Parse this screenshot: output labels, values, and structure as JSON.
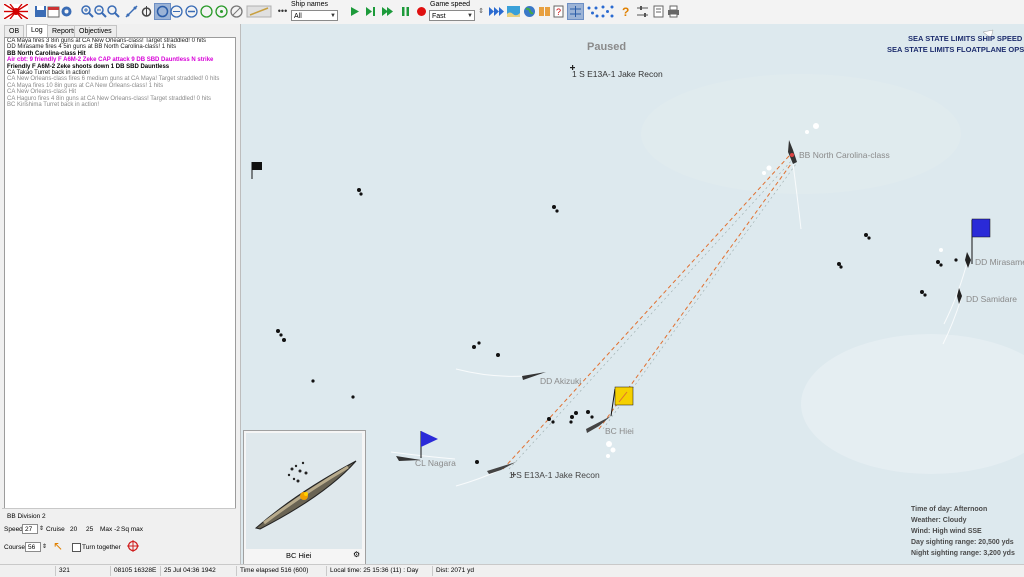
{
  "toolbar": {
    "ship_names_label": "Ship names",
    "ship_names_value": "All",
    "game_speed_label": "Game speed",
    "game_speed_value": "Fast"
  },
  "left_panel": {
    "tabs": [
      "OB",
      "Log",
      "Reports",
      "Objectives"
    ],
    "active_tab": "Log",
    "log": [
      {
        "text": "CA Maya fires 3 8in guns at CA New Orleans-class! Target straddled!  0 hits",
        "style": "dark"
      },
      {
        "text": "DD Mirasame fires 4 5in guns at BB North Carolina-class! 1 hits",
        "style": "dark"
      },
      {
        "text": "BB North Carolina-class Hit",
        "style": "bold"
      },
      {
        "text": "Air cbt: 9 friendly F A6M-2 Zeke CAP attack 9 DB SBD Dauntless N strike",
        "style": "mag"
      },
      {
        "text": "  Friendly F A6M-2 Zeke shoots down 1 DB SBD Dauntless",
        "style": "bold"
      },
      {
        "text": "CA Takao Turret back in action!",
        "style": "dark"
      },
      {
        "text": "CA New Orleans-class fires 6 medium guns at CA Maya! Target straddled!  0 hits",
        "style": "grey"
      },
      {
        "text": "CA Maya fires 10 8in guns at CA New Orleans-class! 1 hits",
        "style": "grey"
      },
      {
        "text": "CA New Orleans-class Hit",
        "style": "grey"
      },
      {
        "text": "CA Haguro fires 4 8in guns at CA New Orleans-class! Target straddled!  0 hits",
        "style": "grey"
      },
      {
        "text": "BC Kirishima Turret back in action!",
        "style": "grey"
      }
    ],
    "division": "BB Division 2",
    "speed_label": "Speed",
    "speed_value": "27",
    "cruise_label": "Cruise",
    "cruise_value": "20",
    "max_value": "25",
    "max_label": "Max -2",
    "sq_label": "Sq max",
    "course_label": "Course",
    "course_value": "56",
    "turn_together_label": "Turn together"
  },
  "map": {
    "paused": "Paused",
    "sea_state_1": "SEA STATE LIMITS SHIP SPEED",
    "sea_state_2": "SEA STATE LIMITS FLOATPLANE OPS",
    "labels": {
      "jake_top": "1 S E13A-1 Jake Recon",
      "jake_bottom": "1 S E13A-1 Jake Recon",
      "bb_nc": "BB North Carolina-class",
      "dd_mirasame": "DD Mirasame",
      "dd_samidare": "DD Samidare",
      "dd_akizuki": "DD Akizuki",
      "bc_hiei": "BC Hiei",
      "cl_nagara": "CL Nagara"
    },
    "minimap_label": "BC Hiei",
    "info": {
      "time_of_day": "Time of day: Afternoon",
      "weather": "Weather: Cloudy",
      "wind": "Wind: High wind  SSE",
      "day_range": "Day sighting range: 20,500 yds",
      "night_range": "Night sighting range: 3,200 yds"
    }
  },
  "status_bar": {
    "id": "321",
    "coords": "08105 16328E",
    "date": "25 Jul 04:36 1942",
    "elapsed": "Time elapsed 516 (600)",
    "local_time": "Local time: 25 15:36 (11) : Day",
    "dist": "Dist: 2071 yd"
  },
  "colors": {
    "sea": "#dde9ee",
    "torpedo_track": "#e07030",
    "friendly_flag": "#2a2ad8",
    "target_flag": "#f5d000"
  }
}
